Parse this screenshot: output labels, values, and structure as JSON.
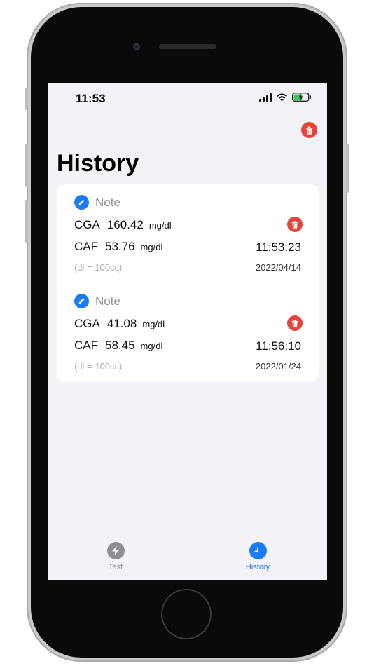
{
  "status_bar": {
    "time": "11:53"
  },
  "header": {
    "title": "History"
  },
  "entries": [
    {
      "note_label": "Note",
      "cga_label": "CGA",
      "cga_value": "160.42",
      "cga_unit": "mg/dl",
      "caf_label": "CAF",
      "caf_value": "53.76",
      "caf_unit": "mg/dl",
      "time": "11:53:23",
      "dl_note": "(dl = 100cc)",
      "date": "2022/04/14"
    },
    {
      "note_label": "Note",
      "cga_label": "CGA",
      "cga_value": "41.08",
      "cga_unit": "mg/dl",
      "caf_label": "CAF",
      "caf_value": "58.45",
      "caf_unit": "mg/dl",
      "time": "11:56:10",
      "dl_note": "(dl = 100cc)",
      "date": "2022/01/24"
    }
  ],
  "tabbar": {
    "tabs": [
      {
        "label": "Test",
        "icon": "bolt-icon",
        "active": false
      },
      {
        "label": "History",
        "icon": "clock-icon",
        "active": true
      }
    ]
  },
  "colors": {
    "accent": "#1c7df3",
    "danger": "#e8443a",
    "inactive": "#8e8e93",
    "background": "#f2f2f7"
  }
}
